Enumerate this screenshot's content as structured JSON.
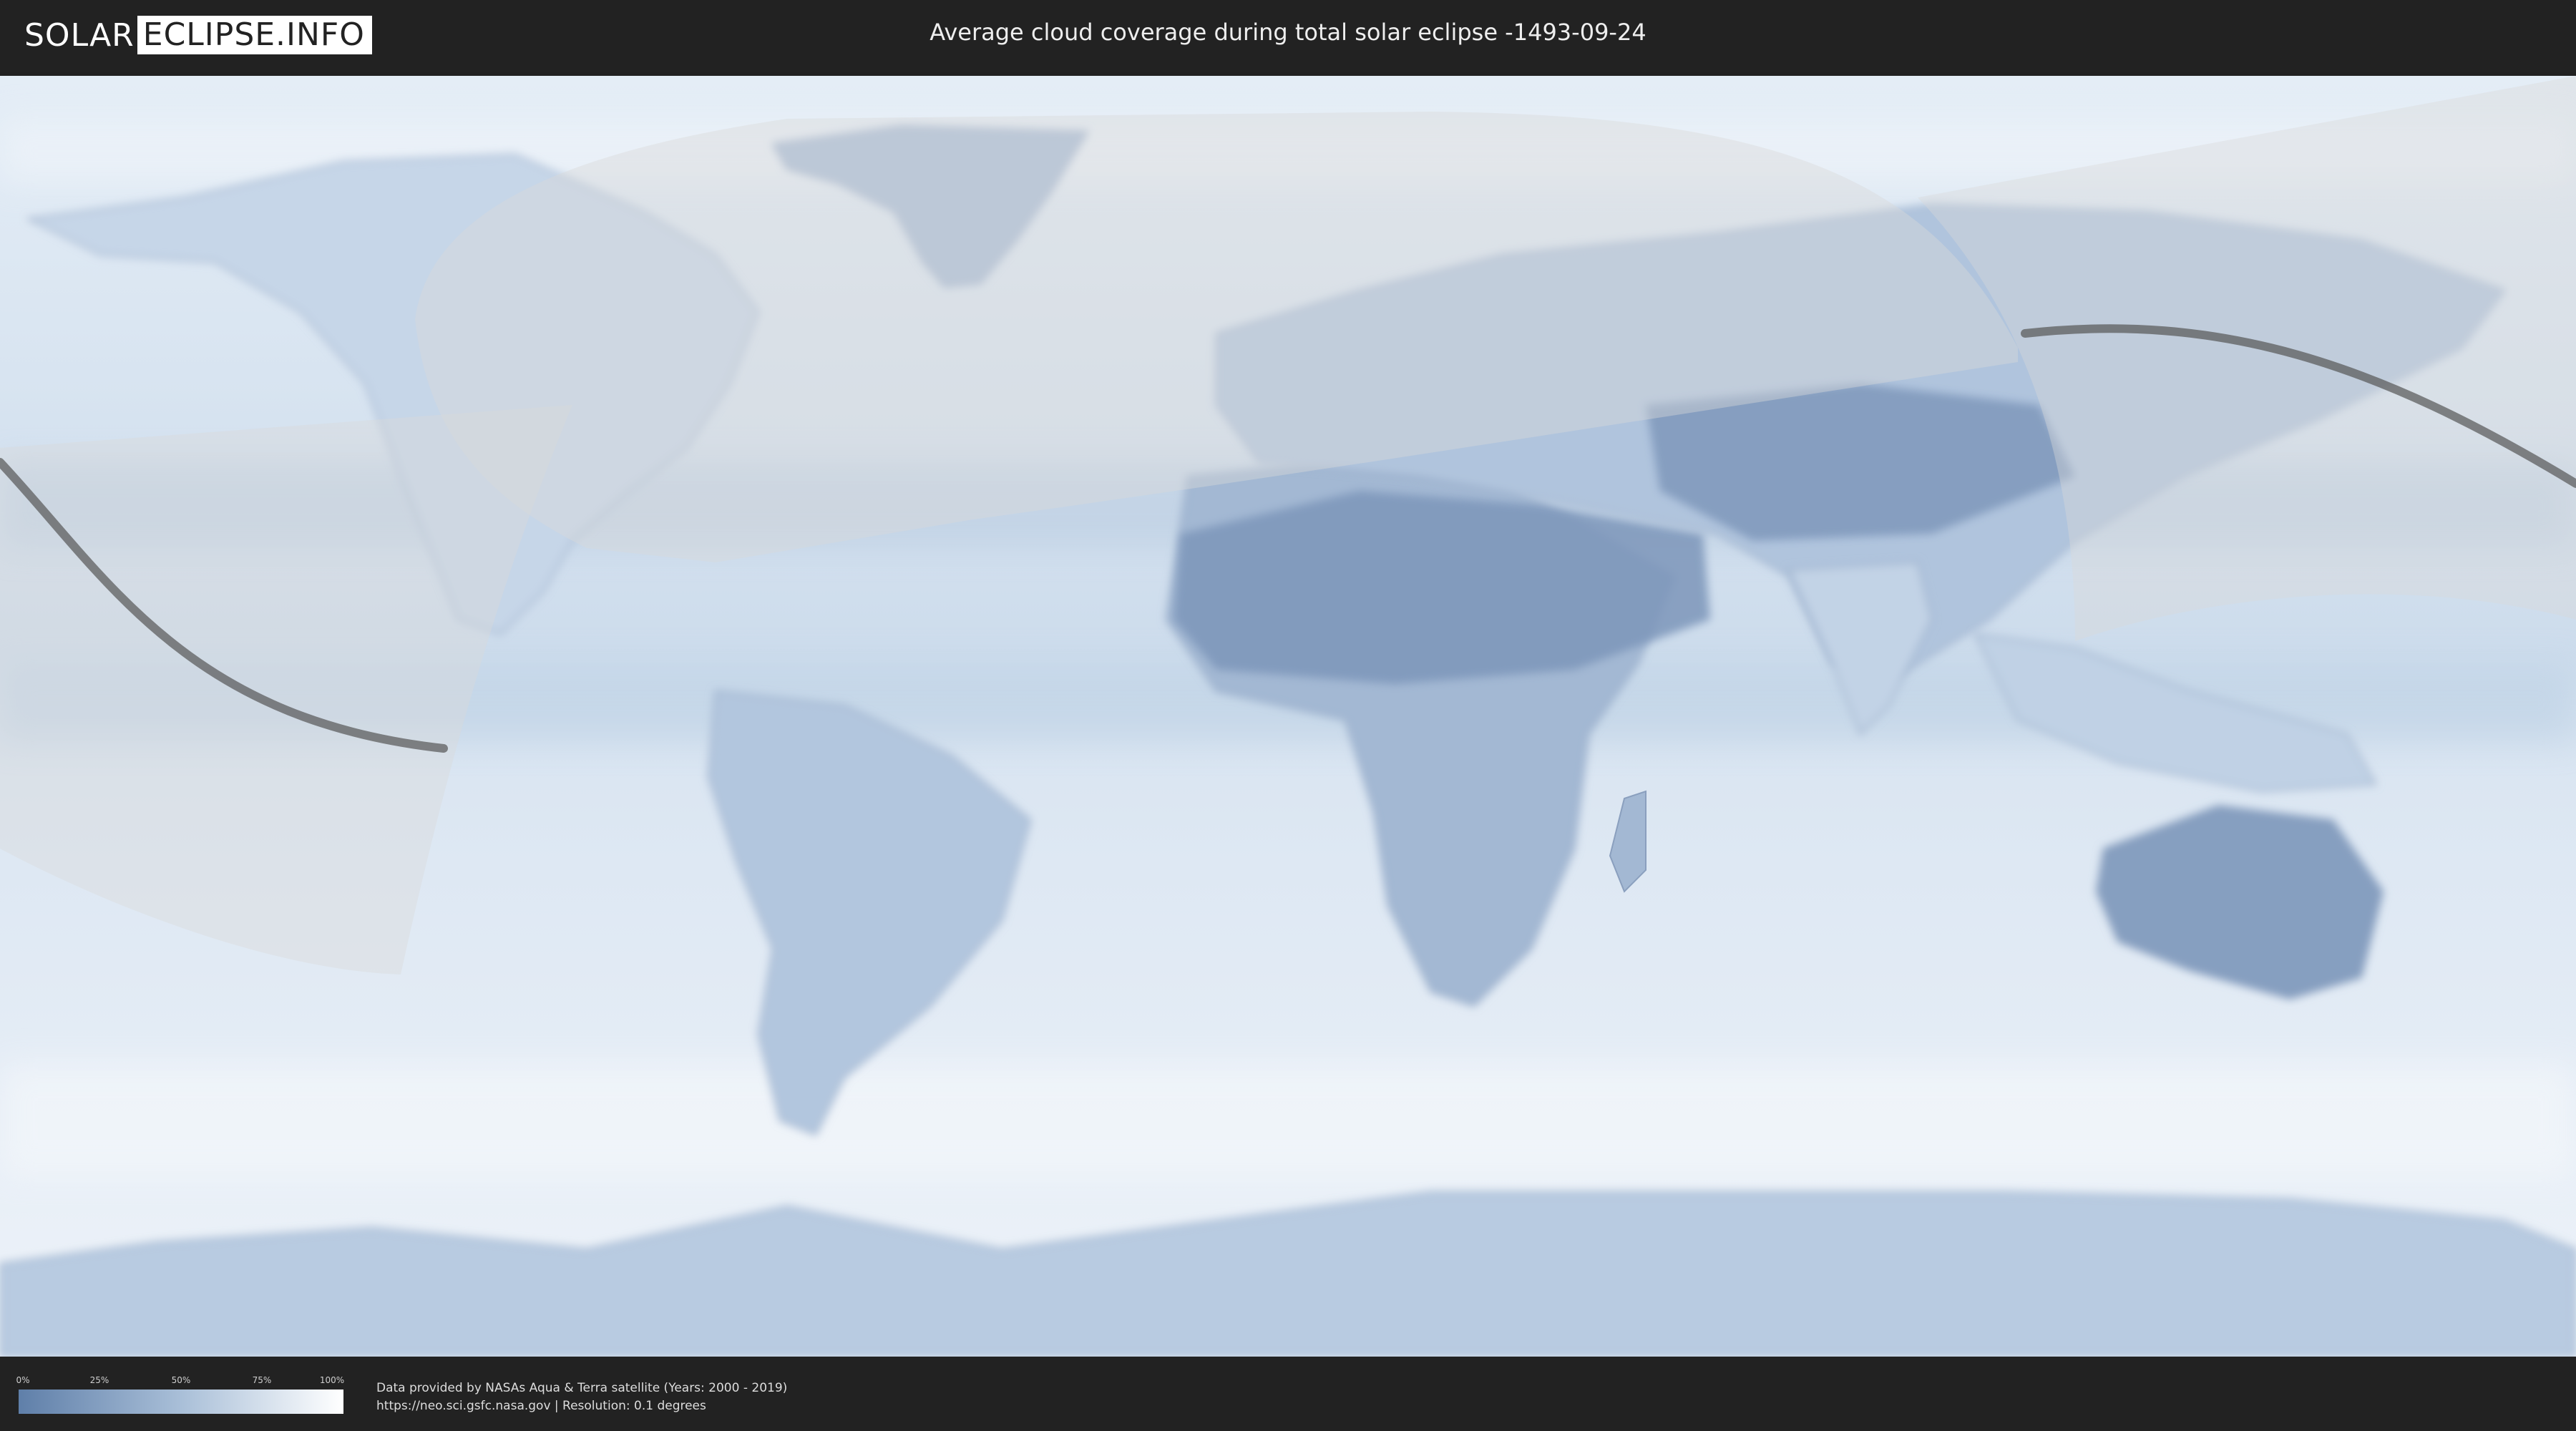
{
  "header": {
    "logo_left": "SOLAR",
    "logo_right": "ECLIPSE.INFO",
    "title": "Average cloud coverage during total solar eclipse -1493-09-24"
  },
  "map": {
    "projection": "equirectangular",
    "colors": {
      "cloud_clear": "#5f7fa9",
      "cloud_full": "#ffffff",
      "overlay": "#d9d9d9",
      "eclipse_path": "#555555"
    }
  },
  "legend": {
    "ticks": [
      "0%",
      "25%",
      "50%",
      "75%",
      "100%"
    ]
  },
  "credits": {
    "line1": "Data provided by NASAs Aqua & Terra satellite (Years: 2000 - 2019)",
    "line2": "https://neo.sci.gsfc.nasa.gov | Resolution: 0.1 degrees"
  }
}
